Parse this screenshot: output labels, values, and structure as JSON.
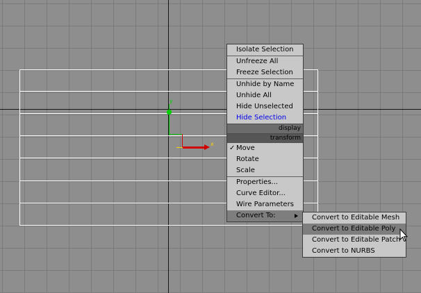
{
  "quad_menu": {
    "items_top": [
      {
        "label": "Isolate Selection"
      },
      {
        "label": "Unfreeze All"
      },
      {
        "label": "Freeze Selection"
      },
      {
        "label": "Unhide by Name"
      },
      {
        "label": "Unhide All"
      },
      {
        "label": "Hide Unselected"
      },
      {
        "label": "Hide Selection"
      }
    ],
    "display_header": "display",
    "transform_header": "transform",
    "items_transform": [
      {
        "label": "Move",
        "checked": true
      },
      {
        "label": "Rotate"
      },
      {
        "label": "Scale"
      },
      {
        "label": "Properties..."
      },
      {
        "label": "Curve Editor..."
      },
      {
        "label": "Wire Parameters"
      },
      {
        "label": "Convert To:"
      }
    ],
    "check_glyph": "✓"
  },
  "submenu": {
    "items": [
      {
        "label": "Convert to Editable Mesh"
      },
      {
        "label": "Convert to Editable Poly"
      },
      {
        "label": "Convert to Editable Patch"
      },
      {
        "label": "Convert to NURBS"
      }
    ]
  },
  "gizmo": {
    "x_label": "x",
    "y_label": "y",
    "colors": {
      "x_axis": "#d00000",
      "y_axis": "#00c000",
      "highlight": "#ffd000"
    }
  },
  "colors": {
    "viewport_bg": "#8e8e8e",
    "grid": "#7a7a7a",
    "menu_bg": "#c8c8c8",
    "menu_header": "#6c6c6c",
    "highlight_blue": "#0000ee"
  }
}
